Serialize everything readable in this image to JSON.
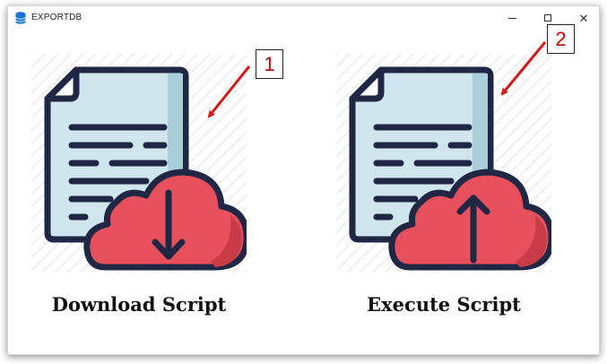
{
  "window": {
    "title": "EXPORTDB",
    "controls": {
      "minimize": "minimize",
      "maximize": "maximize",
      "close": "close"
    }
  },
  "actions": [
    {
      "id": "download",
      "label": "Download Script",
      "icon": "document-cloud-download-icon"
    },
    {
      "id": "execute",
      "label": "Execute Script",
      "icon": "document-cloud-upload-icon"
    }
  ],
  "annotations": [
    {
      "number": "1",
      "color": "#c00000"
    },
    {
      "number": "2",
      "color": "#c00000"
    }
  ],
  "colors": {
    "paper": "#cfe6ee",
    "paper_fold": "#9fc9d6",
    "outline": "#1f2745",
    "cloud": "#e8505b",
    "cloud_shade": "#c93b47",
    "hatch": "#f1f1f1"
  }
}
